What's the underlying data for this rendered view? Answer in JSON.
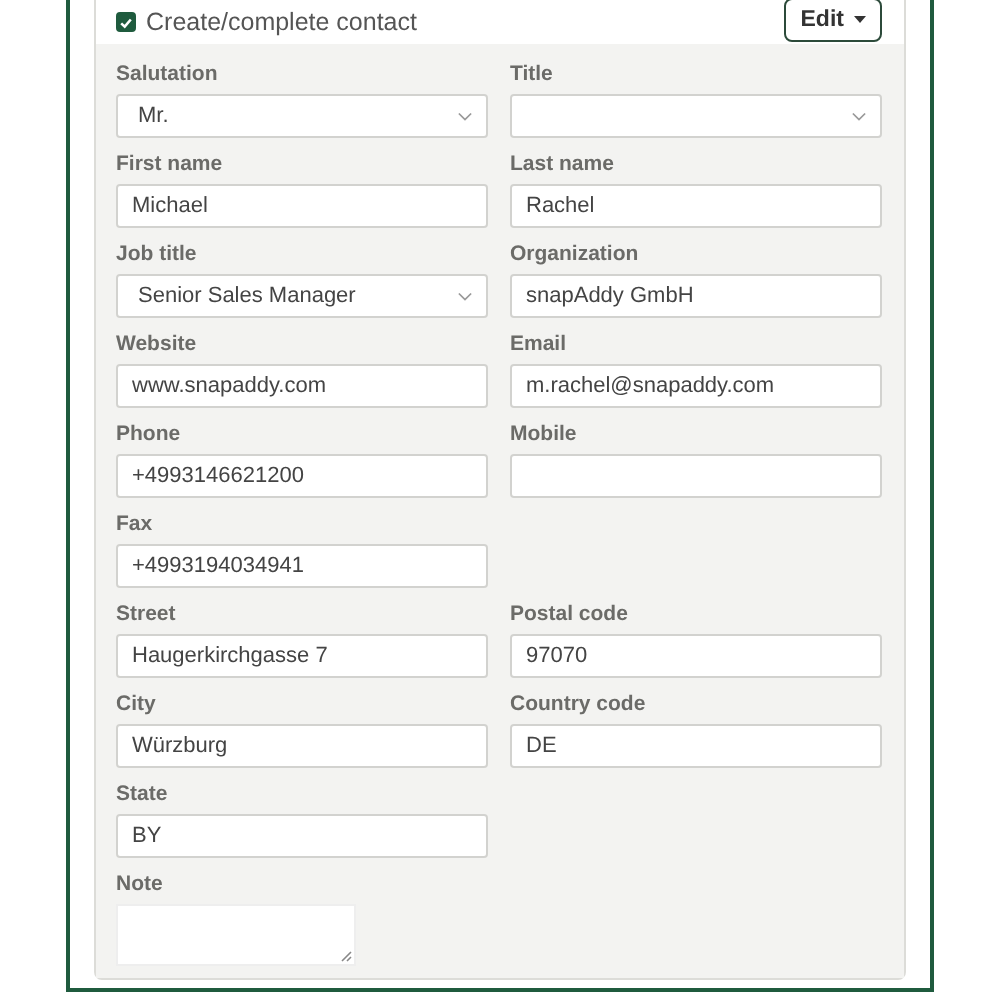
{
  "header": {
    "checkbox": {
      "label": "Create/complete contact",
      "checked": true
    },
    "edit_button": {
      "label": "Edit"
    }
  },
  "rows": [
    {
      "fields": [
        {
          "label": "Salutation",
          "kind": "select",
          "value": "Mr."
        },
        {
          "label": "Title",
          "kind": "select"
        }
      ]
    },
    {
      "fields": [
        {
          "label": "First name",
          "kind": "text",
          "value": "Michael"
        },
        {
          "label": "Last name",
          "kind": "text",
          "value": "Rachel"
        }
      ]
    },
    {
      "fields": [
        {
          "label": "Job title",
          "kind": "select",
          "value": "Senior Sales Manager"
        },
        {
          "label": "Organization",
          "kind": "text",
          "value": "snapAddy GmbH"
        }
      ]
    },
    {
      "fields": [
        {
          "label": "Website",
          "kind": "text",
          "value": "www.snapaddy.com"
        },
        {
          "label": "Email",
          "kind": "text",
          "value": "m.rachel@snapaddy.com"
        }
      ]
    },
    {
      "fields": [
        {
          "label": "Phone",
          "kind": "text",
          "value": "+4993146621200"
        },
        {
          "label": "Mobile",
          "kind": "text"
        }
      ]
    },
    {
      "fields": [
        {
          "label": "Fax",
          "kind": "text",
          "value": "+4993194034941"
        }
      ]
    },
    {
      "fields": [
        {
          "label": "Street",
          "kind": "text",
          "value": "Haugerkirchgasse 7"
        },
        {
          "label": "Postal code",
          "kind": "text",
          "value": "97070"
        }
      ]
    },
    {
      "fields": [
        {
          "label": "City",
          "kind": "text",
          "value": "Würzburg"
        },
        {
          "label": "Country code",
          "kind": "text",
          "value": "DE"
        }
      ]
    },
    {
      "fields": [
        {
          "label": "State",
          "kind": "text",
          "value": "BY"
        }
      ]
    },
    {
      "fields": [
        {
          "label": "Note",
          "kind": "textarea"
        }
      ]
    }
  ]
}
